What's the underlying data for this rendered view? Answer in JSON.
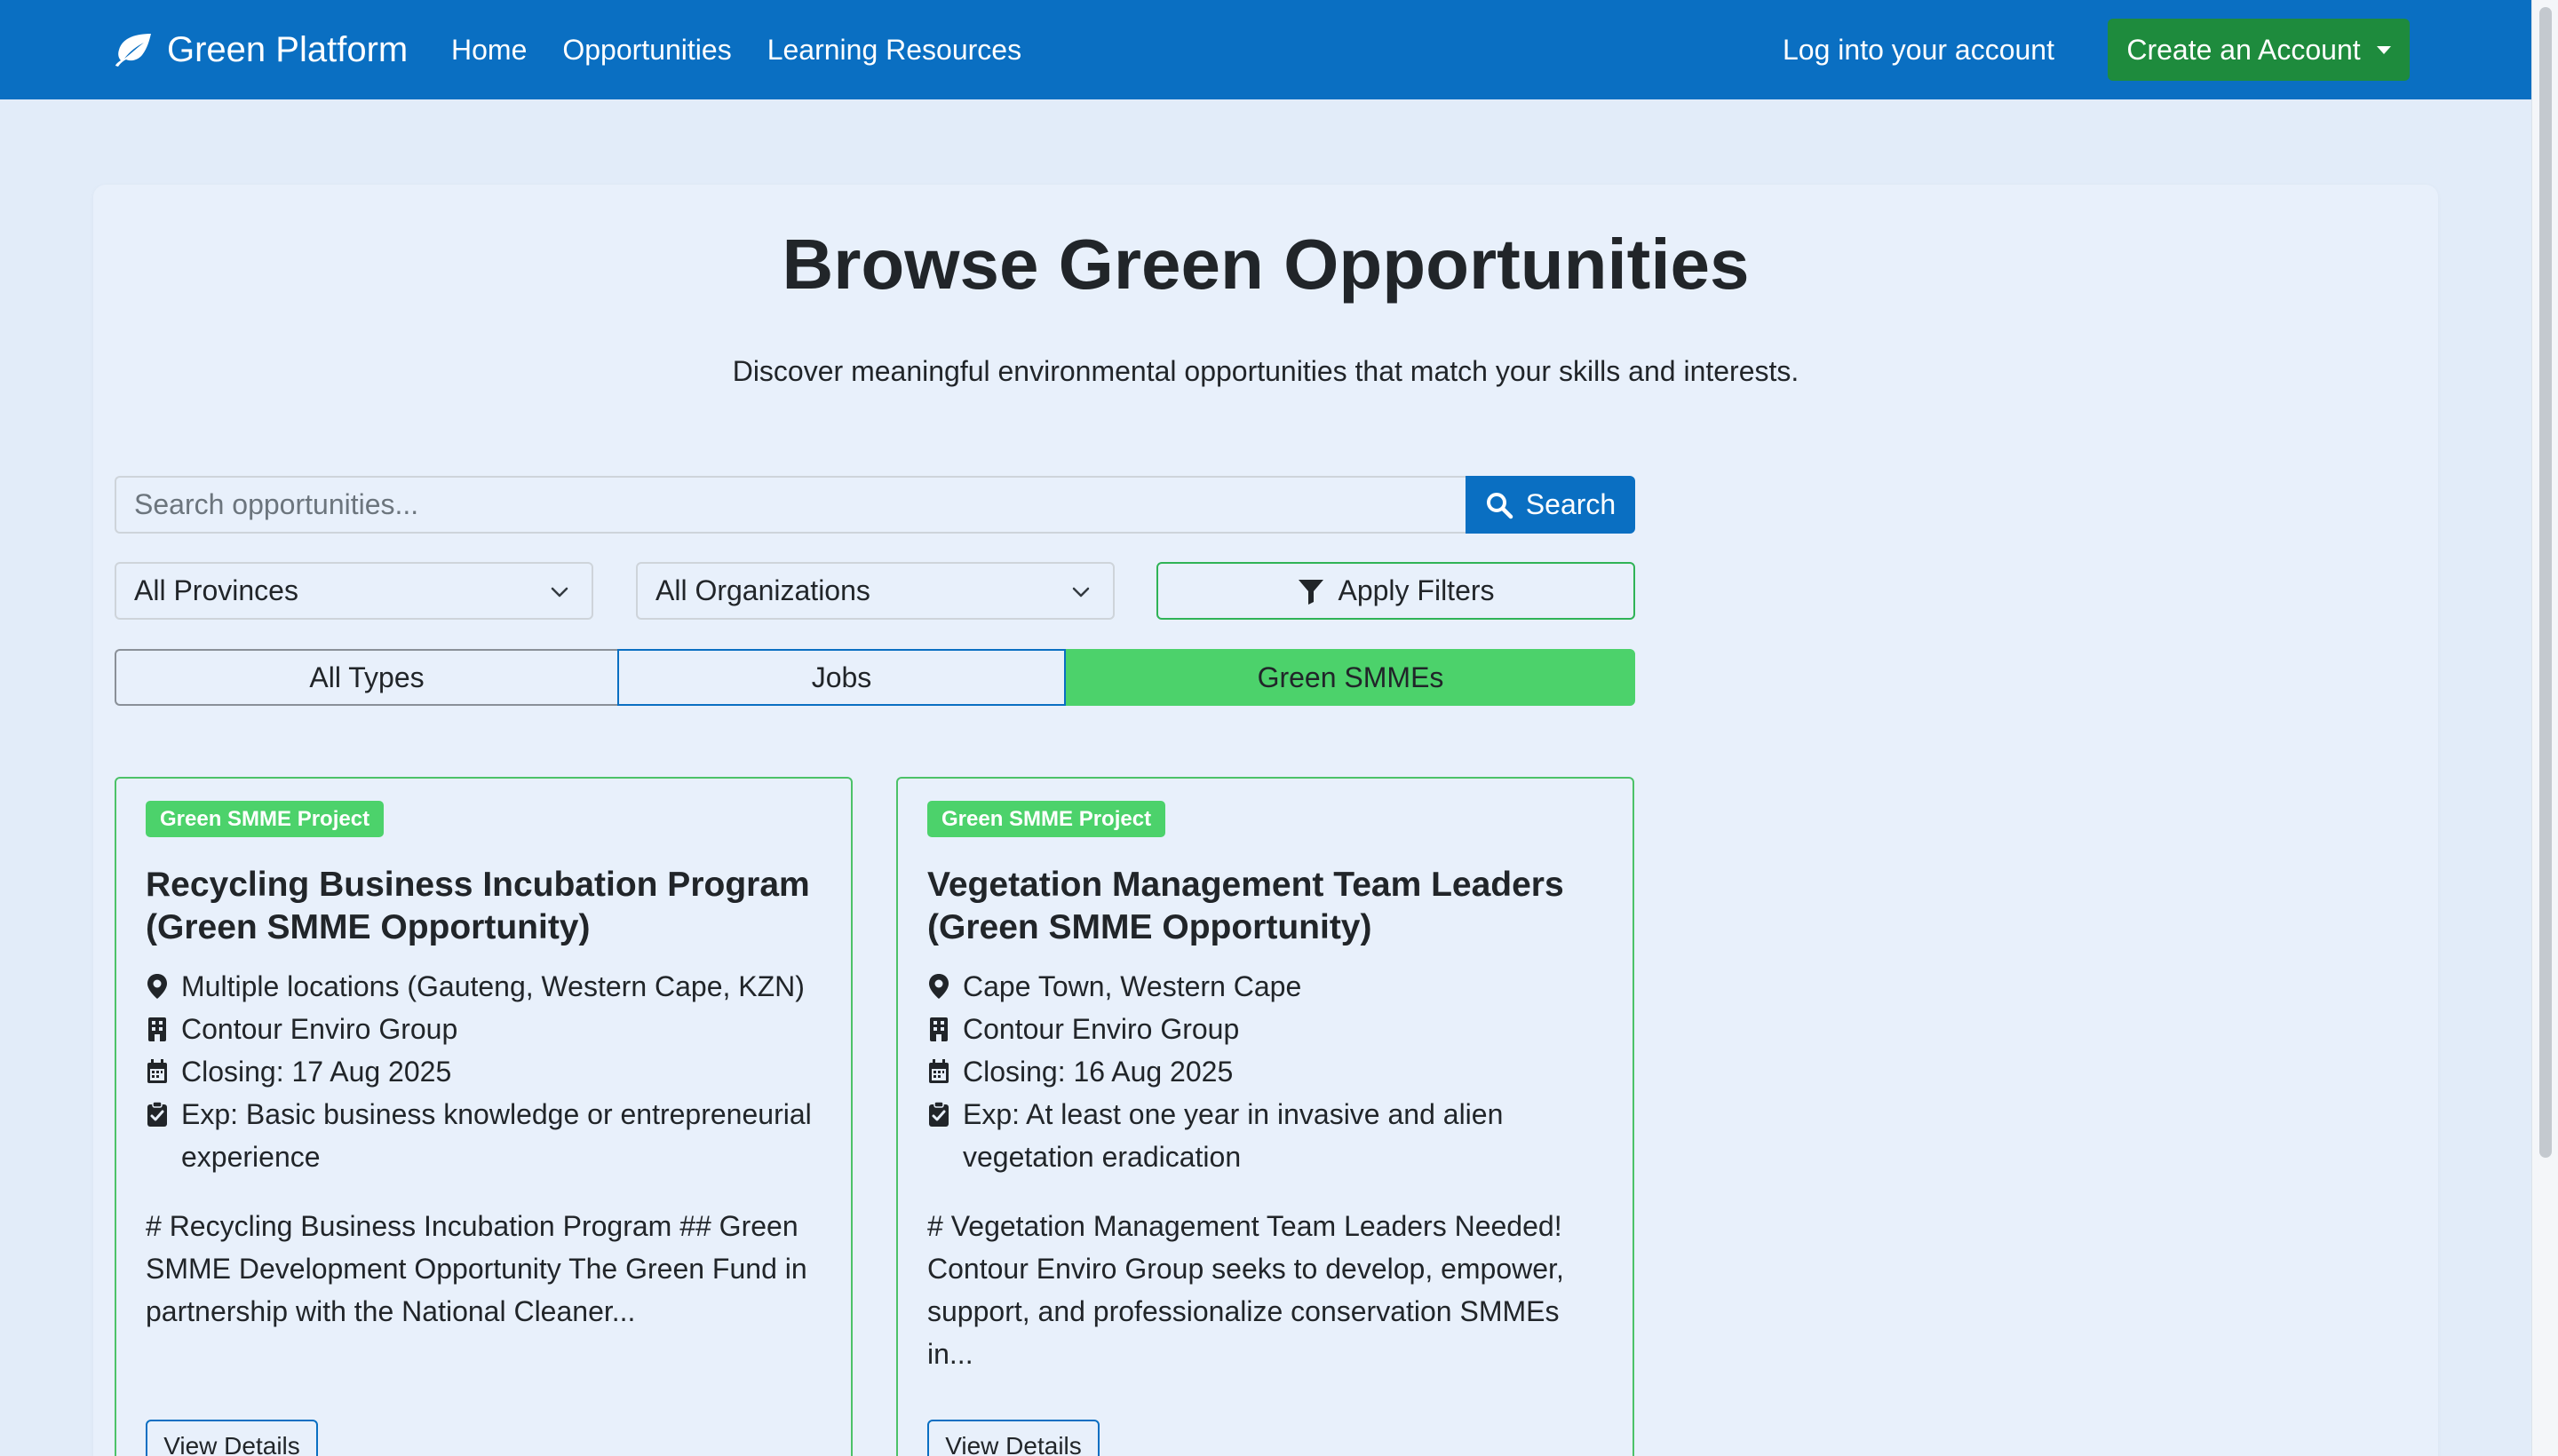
{
  "navbar": {
    "brand": "Green Platform",
    "brand_icon": "leaf-icon",
    "links": [
      "Home",
      "Opportunities",
      "Learning Resources"
    ],
    "login": "Log into your account",
    "create_account": "Create an Account",
    "colors": {
      "background": "#0a6fc2",
      "create_button": "#1e8b3d"
    }
  },
  "header": {
    "title": "Browse Green Opportunities",
    "subtitle": "Discover meaningful environmental opportunities that match your skills and interests."
  },
  "search": {
    "placeholder": "Search opportunities...",
    "button": "Search"
  },
  "filters": {
    "province": "All Provinces",
    "organization": "All Organizations",
    "apply": "Apply Filters"
  },
  "types": {
    "all": "All Types",
    "jobs": "Jobs",
    "smme": "Green SMMEs",
    "active": "Green SMMEs",
    "active_color": "#4cd26b"
  },
  "opportunities": [
    {
      "badge": "Green SMME Project",
      "title": "Recycling Business Incubation Program (Green SMME Opportunity)",
      "location": "Multiple locations (Gauteng, Western Cape, KZN)",
      "organization": "Contour Enviro Group",
      "closing": "Closing: 17 Aug 2025",
      "experience": "Exp: Basic business knowledge or entrepreneurial experience",
      "description": "# Recycling Business Incubation Program ## Green SMME Development Opportunity The Green Fund in partnership with the National Cleaner...",
      "button": "View Details"
    },
    {
      "badge": "Green SMME Project",
      "title": "Vegetation Management Team Leaders (Green SMME Opportunity)",
      "location": "Cape Town, Western Cape",
      "organization": "Contour Enviro Group",
      "closing": "Closing: 16 Aug 2025",
      "experience": "Exp: At least one year in invasive and alien vegetation eradication",
      "description": "# Vegetation Management Team Leaders Needed! Contour Enviro Group seeks to develop, empower, support, and professionalize conservation SMMEs in...",
      "button": "View Details"
    }
  ]
}
